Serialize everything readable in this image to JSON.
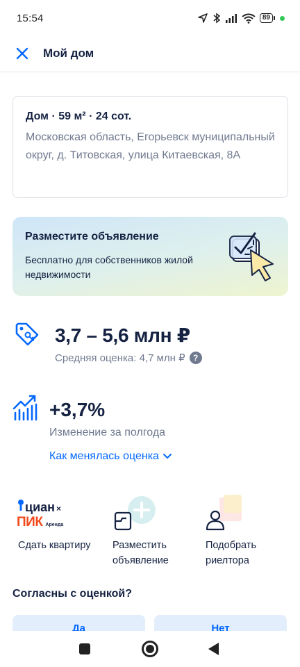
{
  "status_bar": {
    "time": "15:54",
    "battery": "89",
    "icons": [
      "location-arrow-icon",
      "bluetooth-icon",
      "signal-icon",
      "wifi-icon",
      "battery-icon"
    ]
  },
  "header": {
    "title": "Мой дом",
    "close_icon": "close-icon"
  },
  "address_card": {
    "title": "Дом · 59 м² · 24 сот.",
    "address": "Московская область, Егорьевск муниципальный округ, д. Титовская, улица Китаевская, 8А"
  },
  "promo": {
    "title": "Разместите объявление",
    "subtitle": "Бесплатно для собственников жилой недвижимости"
  },
  "estimate": {
    "range": "3,7 – 5,6 млн ₽",
    "average": "Средняя оценка: 4,7 млн ₽",
    "help": "?"
  },
  "change": {
    "value": "+3,7%",
    "label": "Изменение за полгода",
    "link": "Как менялась оценка"
  },
  "services": [
    {
      "brand_top": "циан",
      "brand_x": "×",
      "brand_bottom": "ПИК",
      "brand_small": "Аренда",
      "label": "Сдать квартиру"
    },
    {
      "label": "Разместить объявление"
    },
    {
      "label": "Подобрать риелтора"
    }
  ],
  "agree": {
    "title": "Согласны с оценкой?",
    "yes": "Да",
    "no": "Нет"
  },
  "colors": {
    "primary_text": "#152242",
    "secondary_text": "#707a8f",
    "accent_blue": "#0468ff",
    "pik_orange": "#f24a1d"
  }
}
